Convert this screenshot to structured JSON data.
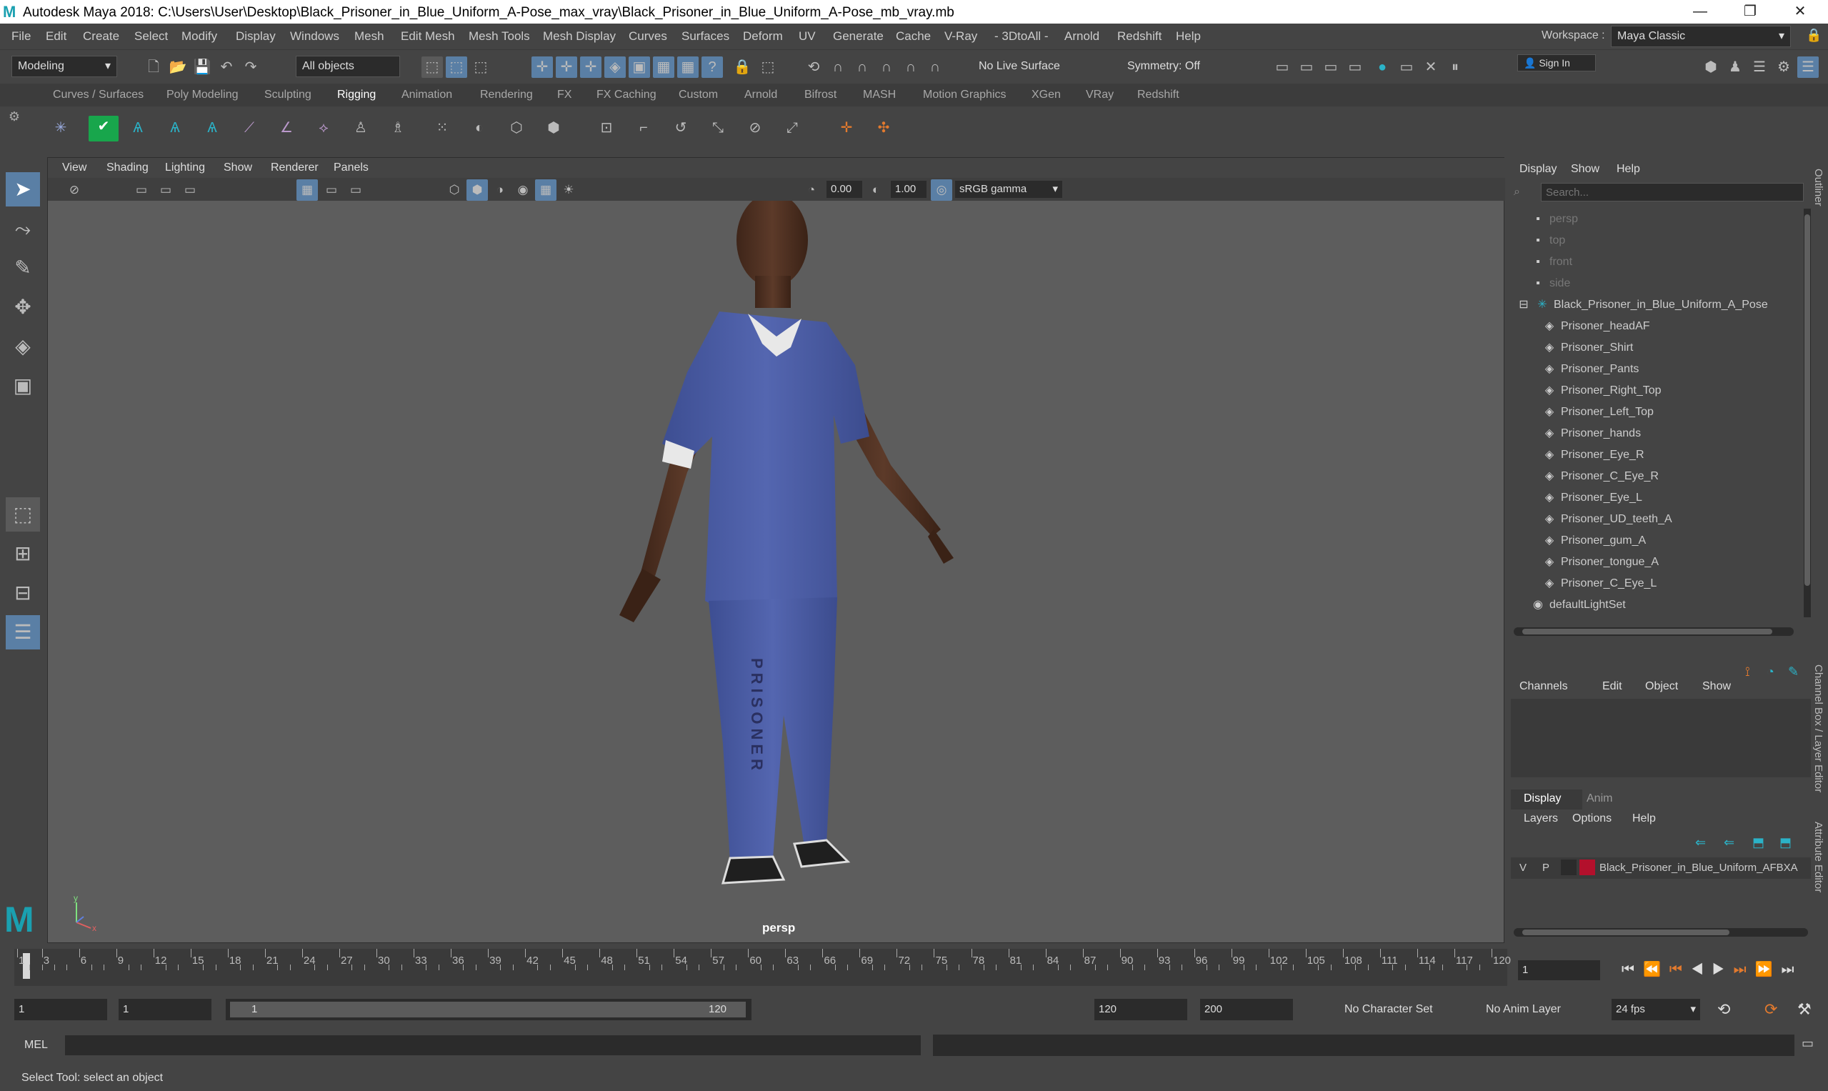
{
  "window": {
    "title": "Autodesk Maya 2018: C:\\Users\\User\\Desktop\\Black_Prisoner_in_Blue_Uniform_A-Pose_max_vray\\Black_Prisoner_in_Blue_Uniform_A-Pose_mb_vray.mb",
    "minimize": "—",
    "maximize": "❐",
    "close": "✕"
  },
  "menubar": {
    "items": [
      "File",
      "Edit",
      "Create",
      "Select",
      "Modify",
      "Display",
      "Windows",
      "Mesh",
      "Edit Mesh",
      "Mesh Tools",
      "Mesh Display",
      "Curves",
      "Surfaces",
      "Deform",
      "UV",
      "Generate",
      "Cache",
      "V-Ray",
      "- 3DtoAll -",
      "Arnold",
      "Redshift",
      "Help"
    ],
    "workspace_label": "Workspace :",
    "workspace_value": "Maya Classic"
  },
  "statusline": {
    "mode": "Modeling",
    "selection_mask": "All objects",
    "live_surface": "No Live Surface",
    "symmetry": "Symmetry: Off",
    "sign_in": "Sign In"
  },
  "shelf_tabs": [
    "Curves / Surfaces",
    "Poly Modeling",
    "Sculpting",
    "Rigging",
    "Animation",
    "Rendering",
    "FX",
    "FX Caching",
    "Custom",
    "Arnold",
    "Bifrost",
    "MASH",
    "Motion Graphics",
    "XGen",
    "VRay",
    "Redshift"
  ],
  "shelf_active": "Rigging",
  "viewport": {
    "menu": [
      "View",
      "Shading",
      "Lighting",
      "Show",
      "Renderer",
      "Panels"
    ],
    "exposure": "0.00",
    "gamma": "1.00",
    "color_space": "sRGB gamma",
    "camera_label": "persp",
    "pants_text": "PRISONER"
  },
  "outliner": {
    "menu": [
      "Display",
      "Show",
      "Help"
    ],
    "search_placeholder": "Search...",
    "items": [
      {
        "label": "persp",
        "type": "camera",
        "dim": true,
        "indent": 0
      },
      {
        "label": "top",
        "type": "camera",
        "dim": true,
        "indent": 0
      },
      {
        "label": "front",
        "type": "camera",
        "dim": true,
        "indent": 0
      },
      {
        "label": "side",
        "type": "camera",
        "dim": true,
        "indent": 0
      },
      {
        "label": "Black_Prisoner_in_Blue_Uniform_A_Pose",
        "type": "joint",
        "dim": false,
        "indent": 0
      },
      {
        "label": "Prisoner_headAF",
        "type": "mesh",
        "dim": false,
        "indent": 1
      },
      {
        "label": "Prisoner_Shirt",
        "type": "mesh",
        "dim": false,
        "indent": 1
      },
      {
        "label": "Prisoner_Pants",
        "type": "mesh",
        "dim": false,
        "indent": 1
      },
      {
        "label": "Prisoner_Right_Top",
        "type": "mesh",
        "dim": false,
        "indent": 1
      },
      {
        "label": "Prisoner_Left_Top",
        "type": "mesh",
        "dim": false,
        "indent": 1
      },
      {
        "label": "Prisoner_hands",
        "type": "mesh",
        "dim": false,
        "indent": 1
      },
      {
        "label": "Prisoner_Eye_R",
        "type": "mesh",
        "dim": false,
        "indent": 1
      },
      {
        "label": "Prisoner_C_Eye_R",
        "type": "mesh",
        "dim": false,
        "indent": 1
      },
      {
        "label": "Prisoner_Eye_L",
        "type": "mesh",
        "dim": false,
        "indent": 1
      },
      {
        "label": "Prisoner_UD_teeth_A",
        "type": "mesh",
        "dim": false,
        "indent": 1
      },
      {
        "label": "Prisoner_gum_A",
        "type": "mesh",
        "dim": false,
        "indent": 1
      },
      {
        "label": "Prisoner_tongue_A",
        "type": "mesh",
        "dim": false,
        "indent": 1
      },
      {
        "label": "Prisoner_C_Eye_L",
        "type": "mesh",
        "dim": false,
        "indent": 1
      },
      {
        "label": "defaultLightSet",
        "type": "set",
        "dim": false,
        "indent": 0
      }
    ]
  },
  "channelbox": {
    "menu": [
      "Channels",
      "Edit",
      "Object",
      "Show"
    ]
  },
  "layers": {
    "tabs": [
      "Display",
      "Anim"
    ],
    "menu": [
      "Layers",
      "Options",
      "Help"
    ],
    "layer": {
      "v": "V",
      "p": "P",
      "name": "Black_Prisoner_in_Blue_Uniform_AFBXA",
      "color": "#b3102c"
    }
  },
  "side_tabs": {
    "outliner": "Outliner",
    "channel": "Channel Box / Layer Editor",
    "attribute": "Attribute Editor"
  },
  "timeslider": {
    "ticks": [
      "1",
      "3",
      "6",
      "9",
      "12",
      "15",
      "18",
      "21",
      "24",
      "27",
      "30",
      "33",
      "36",
      "39",
      "42",
      "45",
      "48",
      "51",
      "54",
      "57",
      "60",
      "63",
      "66",
      "69",
      "72",
      "75",
      "78",
      "81",
      "84",
      "87",
      "90",
      "93",
      "96",
      "99",
      "102",
      "105",
      "108",
      "111",
      "114",
      "117",
      "120"
    ],
    "current_frame": "1"
  },
  "range": {
    "start": "1",
    "playback_start": "1",
    "slider_start": "1",
    "slider_end": "120",
    "playback_end": "120",
    "end": "200",
    "character_set": "No Character Set",
    "anim_layer": "No Anim Layer",
    "fps": "24 fps"
  },
  "cmdline": {
    "label": "MEL"
  },
  "helpline": {
    "text": "Select Tool: select an object"
  }
}
